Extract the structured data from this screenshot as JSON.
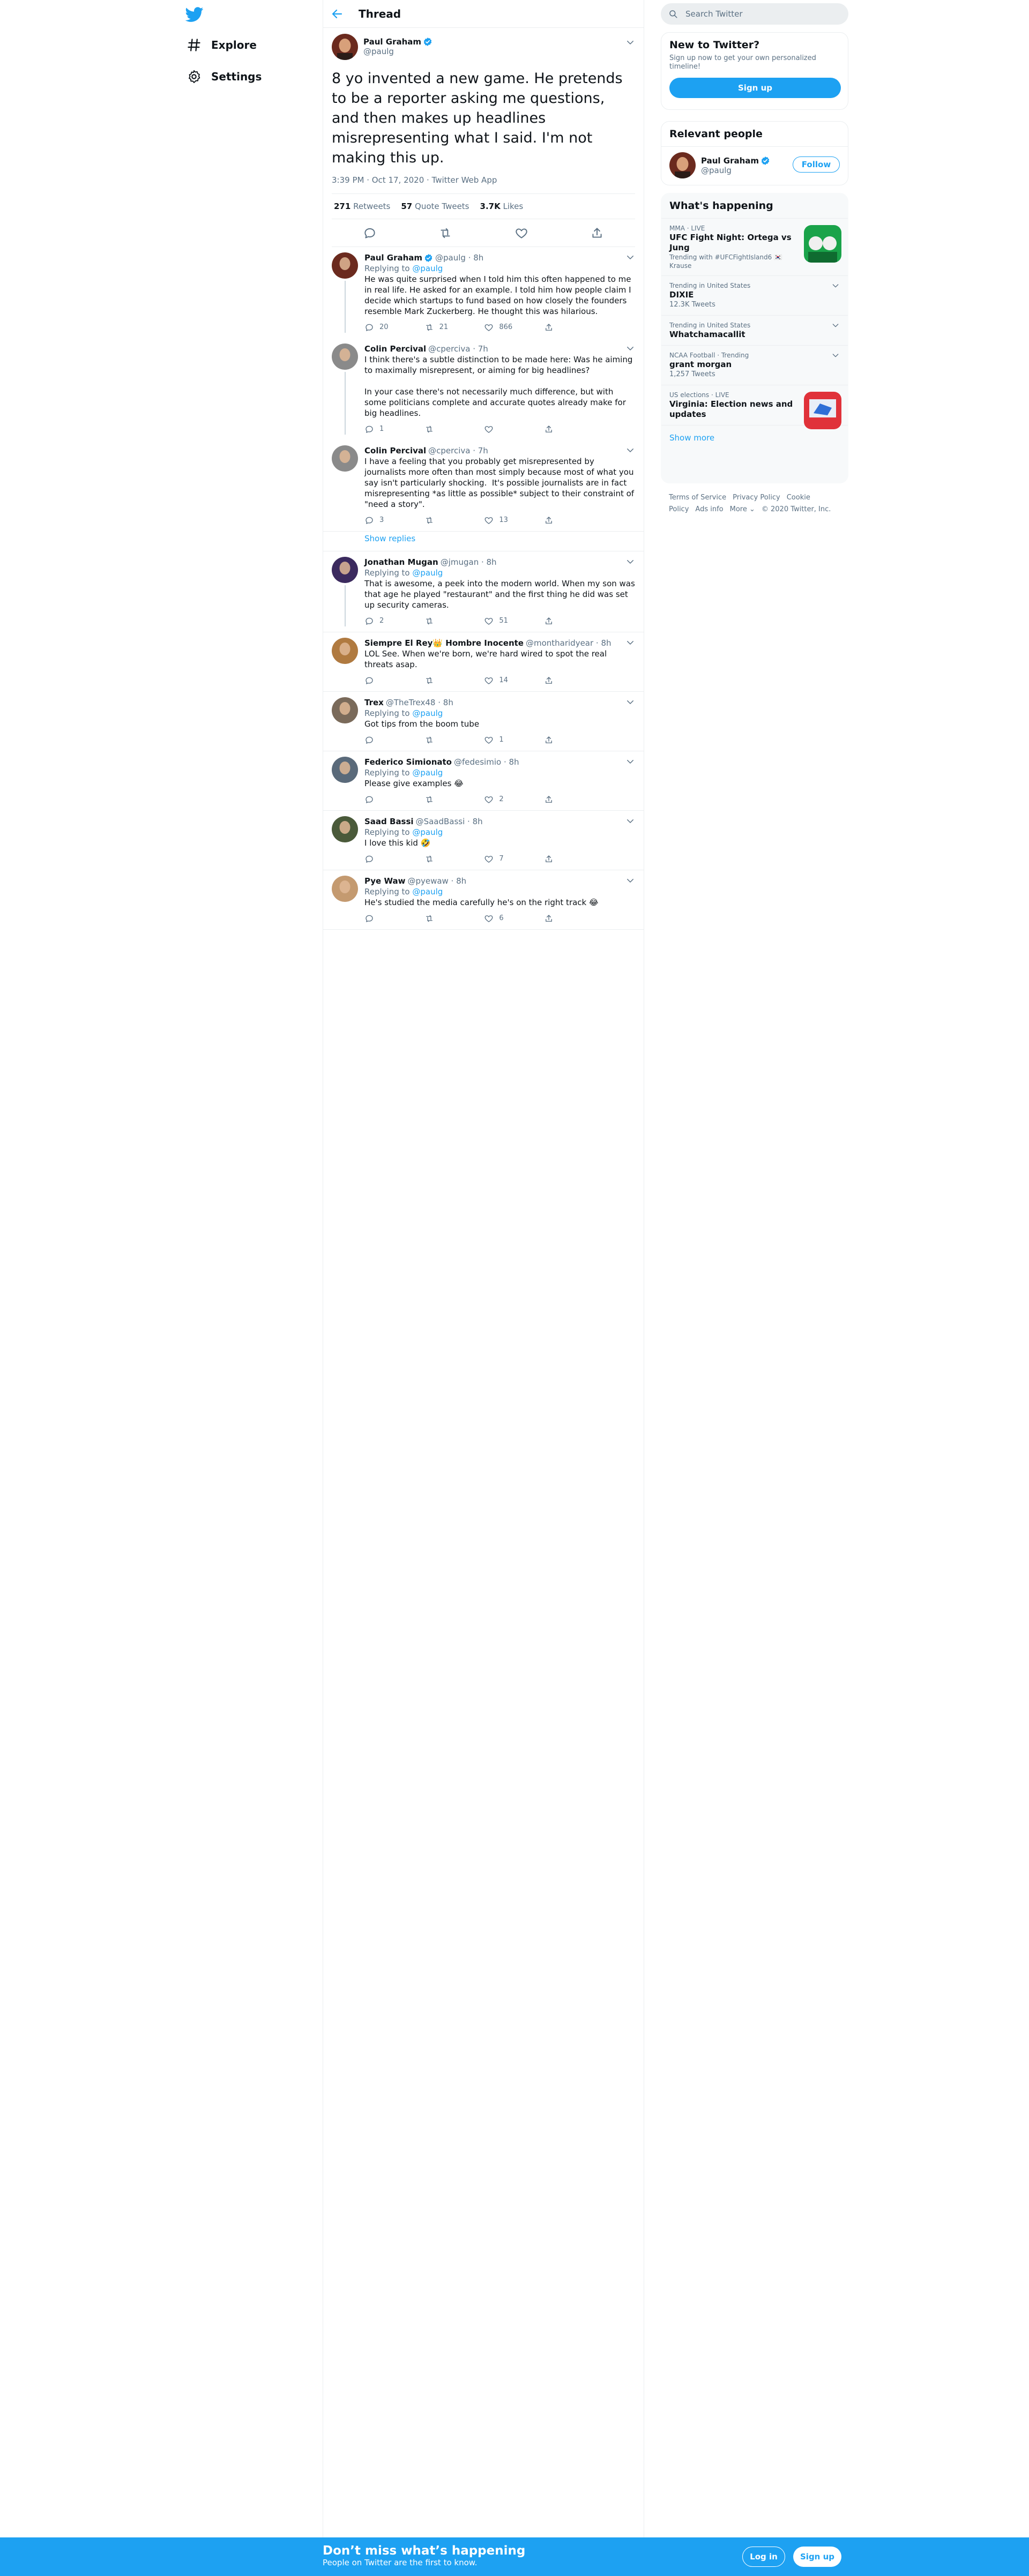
{
  "nav": {
    "explore_label": "Explore",
    "settings_label": "Settings"
  },
  "header": {
    "title": "Thread"
  },
  "main_tweet": {
    "name": "Paul Graham",
    "handle": "@paulg",
    "text": "8 yo invented a new game. He pretends to be a reporter asking me questions, and then makes up headlines misrepresenting what I said. I'm not making this up.",
    "time": "3:39 PM · Oct 17, 2020 · Twitter Web App",
    "retweets": "271",
    "retweets_label": "Retweets",
    "quotes": "57",
    "quotes_label": "Quote Tweets",
    "likes": "3.7K",
    "likes_label": "Likes"
  },
  "replies": [
    {
      "name": "Paul Graham",
      "handle": "@paulg · 8h",
      "replying_to": "@paulg",
      "text": "He was quite surprised when I told him this often happened to me in real life. He asked for an example. I told him how people claim I decide which startups to fund based on how closely the founders resemble Mark Zuckerberg. He thought this was hilarious.",
      "replies": "20",
      "retweets": "21",
      "likes": "866"
    },
    {
      "name": "Colin Percival",
      "handle": "@cperciva · 7h",
      "replying_to": "",
      "text": "I think there's a subtle distinction to be made here: Was he aiming to maximally misrepresent, or aiming for big headlines?\n\nIn your case there's not necessarily much difference, but with some politicians complete and accurate quotes already make for big headlines.",
      "replies": "1",
      "retweets": "",
      "likes": ""
    },
    {
      "name": "Colin Percival",
      "handle": "@cperciva · 7h",
      "replying_to": "",
      "text": "I have a feeling that you probably get misrepresented by journalists more often than most simply because most of what you say isn't particularly shocking.  It's possible journalists are in fact misrepresenting *as little as possible* subject to their constraint of \"need a story\".",
      "replies": "3",
      "retweets": "",
      "likes": "13"
    },
    {
      "name": "Jonathan Mugan",
      "handle": "@jmugan · 8h",
      "replying_to": "@paulg",
      "text": "That is awesome, a peek into the modern world. When my son was that age he played \"restaurant\" and the first thing he did was set up security cameras.",
      "replies": "2",
      "retweets": "",
      "likes": "51"
    },
    {
      "name": "Siempre El Rey👑 Hombre Inocente",
      "handle": "@montharidyear · 8h",
      "replying_to": "",
      "text": "LOL See. When we're born, we're hard wired to spot the real threats asap.",
      "replies": "",
      "retweets": "",
      "likes": "14"
    },
    {
      "name": "Trex",
      "handle": "@TheTrex48 · 8h",
      "replying_to": "@paulg",
      "text": "Got tips from the boom tube",
      "replies": "",
      "retweets": "",
      "likes": "1"
    },
    {
      "name": "Federico Simionato",
      "handle": "@fedesimio · 8h",
      "replying_to": "@paulg",
      "text": "Please give examples 😂",
      "replies": "",
      "retweets": "",
      "likes": "2"
    },
    {
      "name": "Saad Bassi",
      "handle": "@SaadBassi · 8h",
      "replying_to": "@paulg",
      "text": "I love this kid 🤣",
      "replies": "",
      "retweets": "",
      "likes": "7"
    },
    {
      "name": "Pye Waw",
      "handle": "@pyewaw · 8h",
      "replying_to": "@paulg",
      "text": "He's studied the media carefully he's on the right track 😂",
      "replies": "",
      "retweets": "",
      "likes": "6"
    }
  ],
  "replying_prefix": "Replying to",
  "show_replies": "Show replies",
  "search": {
    "placeholder": "Search Twitter"
  },
  "new_to_twitter": {
    "title": "New to Twitter?",
    "text": "Sign up now to get your own personalized timeline!",
    "button": "Sign up"
  },
  "relevant": {
    "title": "Relevant people",
    "name": "Paul Graham",
    "handle": "@paulg",
    "follow": "Follow"
  },
  "trends": {
    "title": "What's happening",
    "items": [
      {
        "meta": "MMA · LIVE",
        "title": "UFC Fight Night: Ortega vs Jung",
        "extra": "Trending with #UFCFightIsland6 🇰🇷 Krause",
        "count": ""
      },
      {
        "meta": "Trending in United States",
        "title": "DIXIE",
        "extra": "",
        "count": "12.3K Tweets"
      },
      {
        "meta": "Trending in United States",
        "title": "Whatchamacallit",
        "extra": "",
        "count": ""
      },
      {
        "meta": "NCAA Football · Trending",
        "title": "grant morgan",
        "extra": "",
        "count": "1,257 Tweets"
      },
      {
        "meta": "US elections · LIVE",
        "title": "Virginia: Election news and updates",
        "extra": "",
        "count": ""
      }
    ],
    "show_more": "Show more"
  },
  "footer": {
    "links": [
      "Terms of Service",
      "Privacy Policy",
      "Cookie Policy",
      "Ads info",
      "More ⌄",
      "© 2020 Twitter, Inc."
    ]
  },
  "banner": {
    "title": "Don’t miss what’s happening",
    "subtitle": "People on Twitter are the first to know.",
    "login": "Log in",
    "signup": "Sign up"
  },
  "colors": {
    "accent": "#1da1f2",
    "text": "#0f1419",
    "secondary": "#5b7083",
    "border": "#ebeef0"
  }
}
